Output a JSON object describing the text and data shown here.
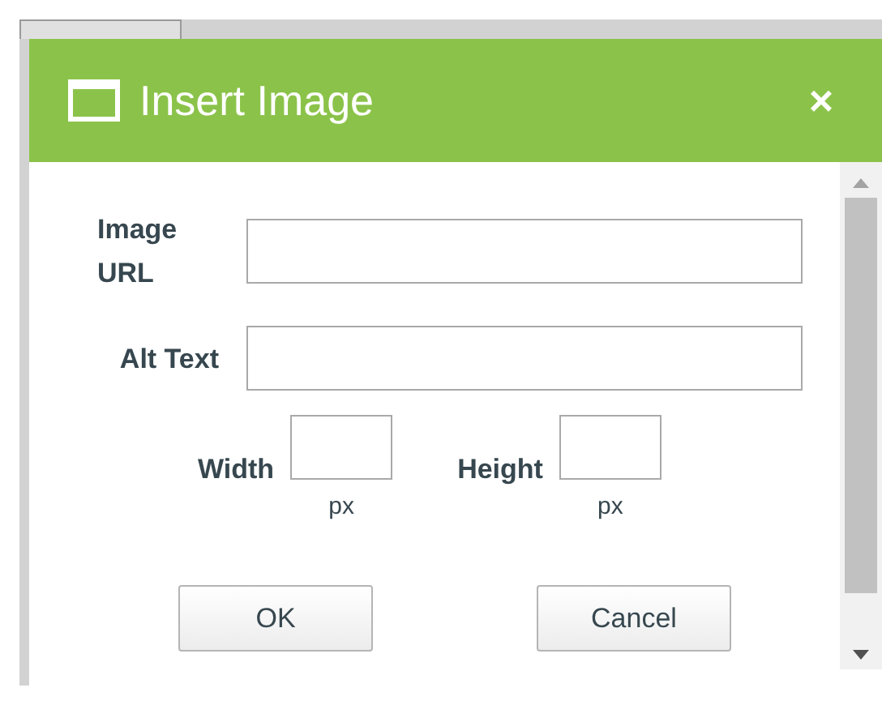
{
  "dialog": {
    "title": "Insert Image",
    "close": "×"
  },
  "fields": [
    {
      "label": "Image URL"
    },
    {
      "label": "Alt Text"
    }
  ],
  "size_fields": [
    {
      "label": "Width",
      "unit": "px"
    },
    {
      "label": "Height",
      "unit": "px"
    }
  ],
  "buttons": [
    "OK",
    "Cancel"
  ]
}
